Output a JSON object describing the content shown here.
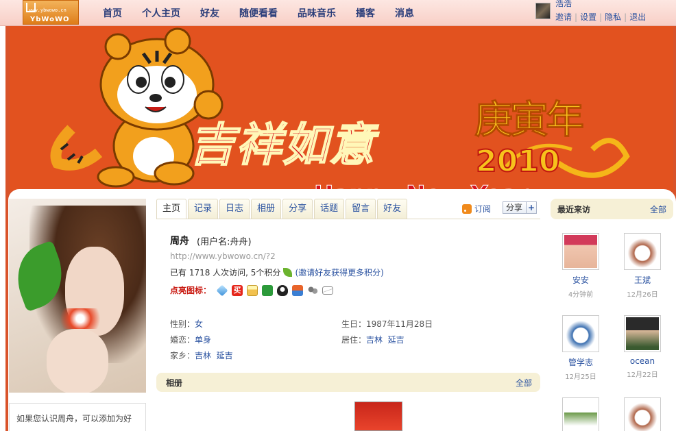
{
  "logo": {
    "url_text": "www.ybwowo.cn",
    "brand_text": "YbWoWO"
  },
  "nav": [
    "首页",
    "个人主页",
    "好友",
    "随便看看",
    "品味音乐",
    "播客",
    "消息"
  ],
  "user": {
    "name": "浩浩",
    "links": [
      "邀请",
      "设置",
      "隐私",
      "退出"
    ]
  },
  "banner": {
    "slogan": "吉祥如意",
    "year_cn": "庚寅年",
    "year_num": "2010",
    "greeting_cn": "庚寅年",
    "greeting_en": "Happy New Year"
  },
  "tabs": [
    "主页",
    "记录",
    "日志",
    "相册",
    "分享",
    "话题",
    "留言",
    "好友"
  ],
  "active_tab": "主页",
  "subscribe_label": "订阅",
  "share_label": "分享",
  "profile": {
    "name": "周舟",
    "username": "(用户名:舟舟)",
    "url": "http://www.ybwowo.cn/?2",
    "stats_text": "已有 1718 人次访问, 5个积分",
    "invite_text": "(邀请好友获得更多积分)",
    "icons_label": "点亮图标："
  },
  "info": {
    "gender_label": "性别：",
    "gender": "女",
    "birthday_label": "生日：",
    "birthday": "1987年11月28日",
    "marital_label": "婚恋：",
    "marital": "单身",
    "residence_label": "居住：",
    "residence_province": "吉林",
    "residence_city": "延吉",
    "hometown_label": "家乡：",
    "hometown_province": "吉林",
    "hometown_city": "延吉"
  },
  "album": {
    "title": "相册",
    "all": "全部"
  },
  "left_box_text": "如果您认识周舟，可以添加为好",
  "recent": {
    "title": "最近来访",
    "all": "全部",
    "visitors": [
      {
        "name": "安安",
        "time": "4分钟前"
      },
      {
        "name": "王斌",
        "time": "12月26日"
      },
      {
        "name": "管学志",
        "time": "12月25日"
      },
      {
        "name": "ocean",
        "time": "12月22日"
      }
    ]
  },
  "colors": {
    "accent": "#2a52a0",
    "banner": "#e2521f",
    "highlight": "#c8170e"
  }
}
